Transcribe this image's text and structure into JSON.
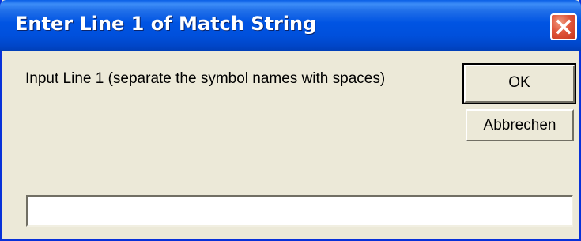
{
  "dialog": {
    "title": "Enter Line 1 of Match String",
    "prompt": "Input Line 1 (separate the symbol names with spaces)",
    "ok_label": "OK",
    "cancel_label": "Abbrechen",
    "input_value": ""
  },
  "icons": {
    "close": "close-icon"
  },
  "colors": {
    "titlebar": "#0054e3",
    "window_background": "#ece9d8",
    "close_button": "#e0553a",
    "border": "#0831d9"
  }
}
